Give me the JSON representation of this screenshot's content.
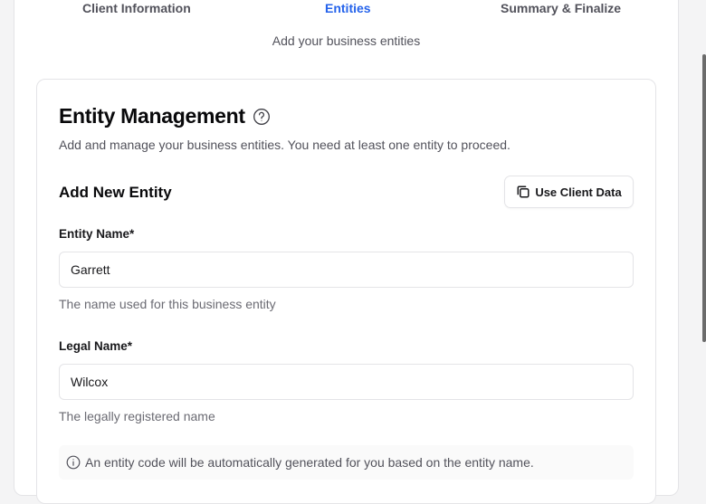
{
  "steps": {
    "client_information": "Client Information",
    "entities": "Entities",
    "summary_finalize": "Summary & Finalize",
    "subtitle": "Add your business entities"
  },
  "entity_management": {
    "title": "Entity Management",
    "help_icon": "help-circle-icon",
    "description": "Add and manage your business entities. You need at least one entity to proceed."
  },
  "add_entity": {
    "title": "Add New Entity",
    "use_client_data_label": "Use Client Data",
    "use_client_data_icon": "copy-icon"
  },
  "form": {
    "entity_name": {
      "label": "Entity Name*",
      "value": "Garrett",
      "hint": "The name used for this business entity"
    },
    "legal_name": {
      "label": "Legal Name*",
      "value": "Wilcox",
      "hint": "The legally registered name"
    }
  },
  "info": {
    "icon": "info-icon",
    "text": "An entity code will be automatically generated for you based on the entity name."
  },
  "colors": {
    "accent": "#2563eb",
    "border": "#e4e4e7",
    "muted_text": "#52525b",
    "background": "#f4f4f5"
  }
}
